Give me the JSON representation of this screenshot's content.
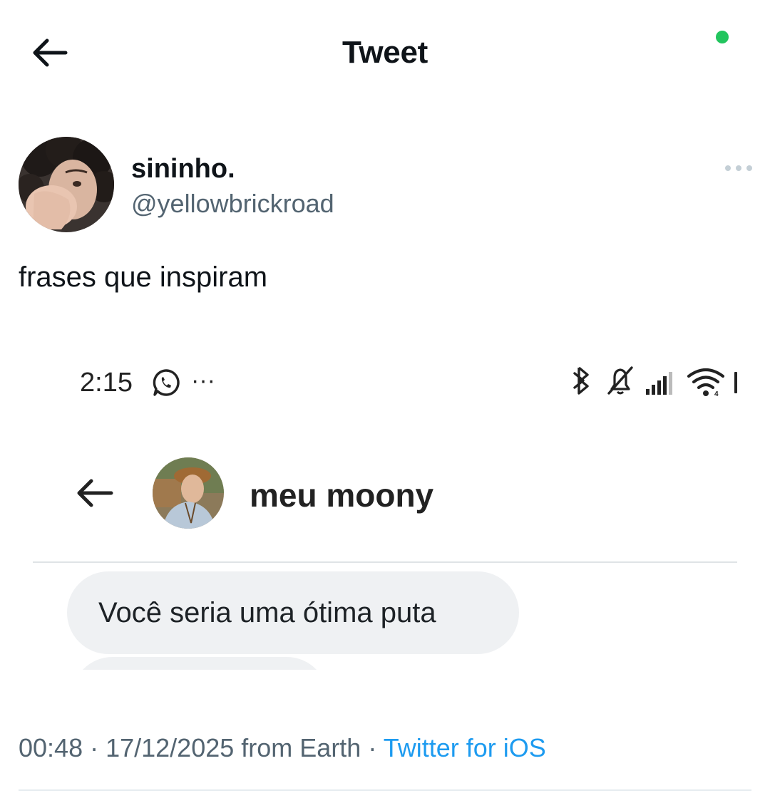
{
  "header": {
    "title": "Tweet",
    "online_color": "#22c55e"
  },
  "author": {
    "display_name": "sininho.",
    "handle": "@yellowbrickroad",
    "avatar_icon": "avatar-photo"
  },
  "tweet": {
    "text": "frases que inspiram"
  },
  "embedded_screenshot": {
    "status_bar": {
      "time": "2:15",
      "dots": "···",
      "icons": [
        "whatsapp-icon",
        "bluetooth-icon",
        "bell-off-icon",
        "signal-icon",
        "wifi-icon",
        "battery-icon"
      ]
    },
    "chat": {
      "contact_name": "meu moony",
      "messages": [
        "Você seria uma ótima puta"
      ],
      "bubble_color": "#eff1f3"
    }
  },
  "meta": {
    "time": "00:48",
    "sep1": " · ",
    "date": "17/12/2025",
    "location": " from Earth",
    "sep2": " · ",
    "source": "Twitter for iOS",
    "link_color": "#1d9bf0"
  }
}
